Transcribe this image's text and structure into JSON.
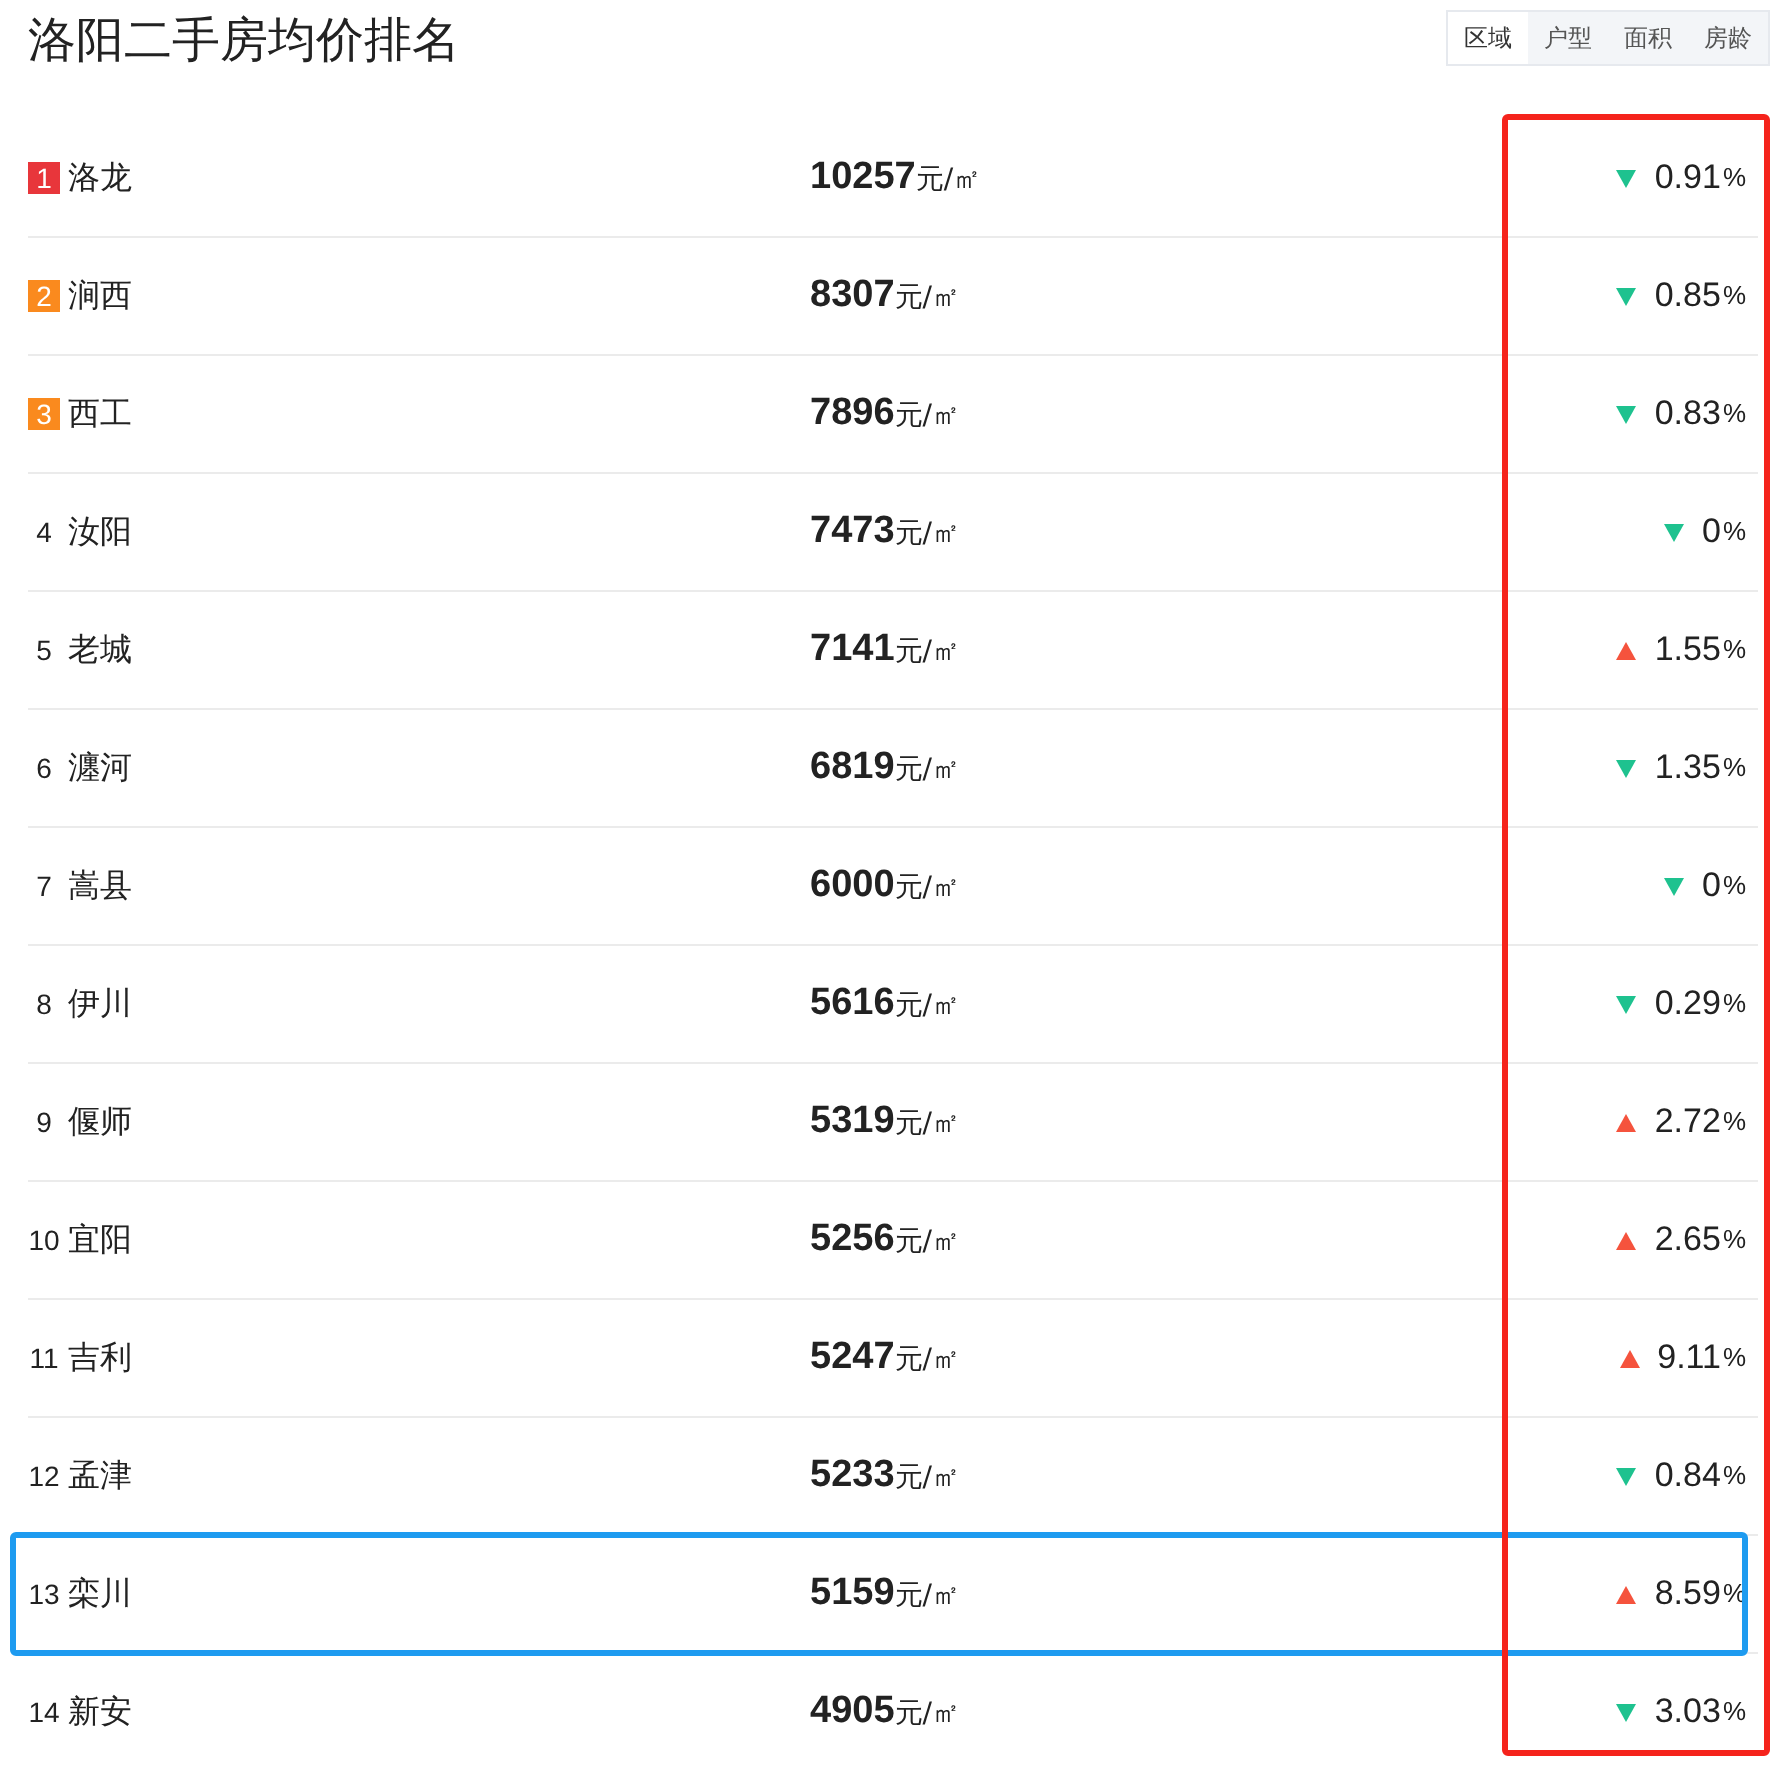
{
  "title": "洛阳二手房均价排名",
  "tabs": [
    {
      "label": "区域",
      "selected": true
    },
    {
      "label": "户型",
      "selected": false
    },
    {
      "label": "面积",
      "selected": false
    },
    {
      "label": "房龄",
      "selected": false
    }
  ],
  "change_column_marked": true,
  "rows": [
    {
      "rank": "1",
      "name": "洛龙",
      "price": "10257",
      "unit": "元/㎡",
      "kind": "down",
      "change": "0.91",
      "percent": "%",
      "highlighted": false
    },
    {
      "rank": "2",
      "name": "涧西",
      "price": "8307",
      "unit": "元/㎡",
      "kind": "down",
      "change": "0.85",
      "percent": "%",
      "highlighted": false
    },
    {
      "rank": "3",
      "name": "西工",
      "price": "7896",
      "unit": "元/㎡",
      "kind": "down",
      "change": "0.83",
      "percent": "%",
      "highlighted": false
    },
    {
      "rank": "4",
      "name": "汝阳",
      "price": "7473",
      "unit": "元/㎡",
      "kind": "down",
      "change": "0",
      "percent": "%",
      "highlighted": false
    },
    {
      "rank": "5",
      "name": "老城",
      "price": "7141",
      "unit": "元/㎡",
      "kind": "up",
      "change": "1.55",
      "percent": "%",
      "highlighted": false
    },
    {
      "rank": "6",
      "name": "瀍河",
      "price": "6819",
      "unit": "元/㎡",
      "kind": "down",
      "change": "1.35",
      "percent": "%",
      "highlighted": false
    },
    {
      "rank": "7",
      "name": "嵩县",
      "price": "6000",
      "unit": "元/㎡",
      "kind": "down",
      "change": "0",
      "percent": "%",
      "highlighted": false
    },
    {
      "rank": "8",
      "name": "伊川",
      "price": "5616",
      "unit": "元/㎡",
      "kind": "down",
      "change": "0.29",
      "percent": "%",
      "highlighted": false
    },
    {
      "rank": "9",
      "name": "偃师",
      "price": "5319",
      "unit": "元/㎡",
      "kind": "up",
      "change": "2.72",
      "percent": "%",
      "highlighted": false
    },
    {
      "rank": "10",
      "name": "宜阳",
      "price": "5256",
      "unit": "元/㎡",
      "kind": "up",
      "change": "2.65",
      "percent": "%",
      "highlighted": false
    },
    {
      "rank": "11",
      "name": "吉利",
      "price": "5247",
      "unit": "元/㎡",
      "kind": "up",
      "change": "9.11",
      "percent": "%",
      "highlighted": false
    },
    {
      "rank": "12",
      "name": "孟津",
      "price": "5233",
      "unit": "元/㎡",
      "kind": "down",
      "change": "0.84",
      "percent": "%",
      "highlighted": false
    },
    {
      "rank": "13",
      "name": "栾川",
      "price": "5159",
      "unit": "元/㎡",
      "kind": "up",
      "change": "8.59",
      "percent": "%",
      "highlighted": true
    },
    {
      "rank": "14",
      "name": "新安",
      "price": "4905",
      "unit": "元/㎡",
      "kind": "down",
      "change": "3.03",
      "percent": "%",
      "highlighted": false
    }
  ]
}
